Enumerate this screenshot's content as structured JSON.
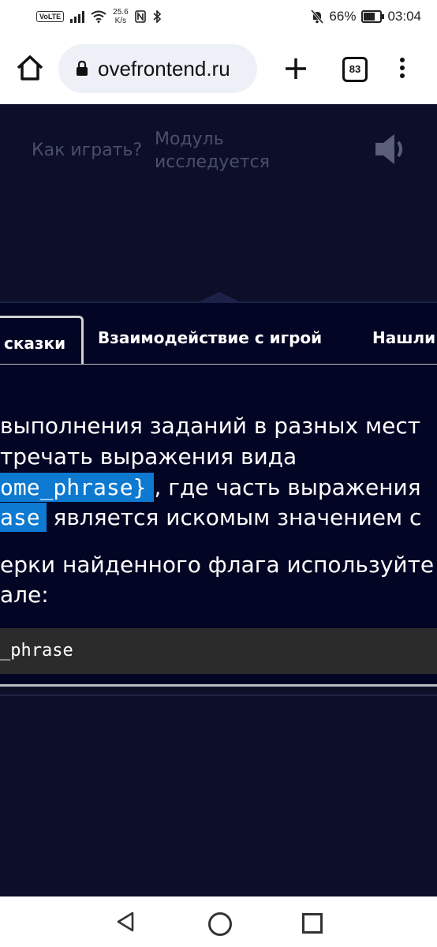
{
  "status_bar": {
    "volte": "VoLTE",
    "speed_value": "25.6",
    "speed_unit": "K/s",
    "battery": "66%",
    "time": "03:04",
    "icons": [
      "signal-icon",
      "wifi-icon",
      "nfc-icon",
      "bluetooth-icon",
      "mute-icon",
      "battery-icon"
    ]
  },
  "browser": {
    "url": "ovefrontend.ru",
    "tab_count": "83",
    "icons": [
      "home-icon",
      "lock-icon",
      "plus-icon",
      "menu-icon"
    ]
  },
  "header": {
    "how_to_play": "Как играть?",
    "module_status_line1": "Модуль",
    "module_status_line2": "исследуется",
    "sound_icon": "speaker-icon"
  },
  "tabs": [
    {
      "label": "сказки",
      "active": true
    },
    {
      "label": "Взаимодействие с игрой",
      "active": false
    },
    {
      "label": "Нашли",
      "active": false
    }
  ],
  "content": {
    "line1": "выполнения заданий в разных мест",
    "line2": "тречать выражения вида",
    "line3_code": "ome_phrase}",
    "line3_text": ", где часть выражения",
    "line4_code": "ase",
    "line4_text": "является искомым значением с",
    "line5": "ерки найденного флага используйте",
    "line6": "але:",
    "code_block": "_phrase"
  },
  "colors": {
    "page_bg": "#0d0f29",
    "panel_bg": "#030524",
    "highlight": "#0d79d1",
    "muted_text": "#4a4f6c",
    "code_bg": "#2b2b2b"
  },
  "nav_bar": {
    "icons": [
      "back-icon",
      "home-circle-icon",
      "recent-apps-icon"
    ]
  }
}
